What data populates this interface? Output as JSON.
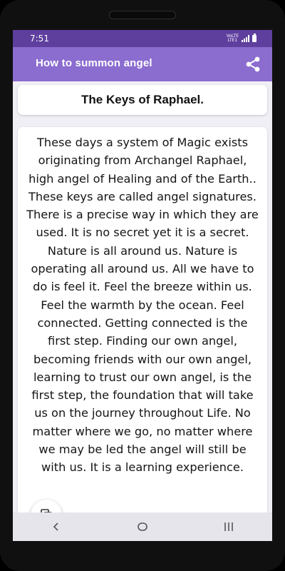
{
  "status_bar": {
    "time": "7:51",
    "network_label_1": "VoLTE",
    "network_label_2": "LTE1"
  },
  "app_bar": {
    "title": "How to summon angel",
    "share_icon": "share-icon"
  },
  "article": {
    "title": "The Keys of Raphael.",
    "body": "These days a system of Magic exists originating from Archangel Raphael, high angel of Healing and of the Earth.. These keys are called angel signatures. There is a precise way in which they are used. It is no secret yet it is a secret. Nature is all around us. Nature is operating all around us. All we have to do is feel it. Feel the breeze within us. Feel the warmth by the ocean. Feel connected. Getting connected is the first step. Finding our own angel, becoming friends with our own angel, learning to trust our own angel, is the first step, the foundation that will take us on the journey throughout Life. No matter where we go, no matter where we may be led the angel will still be with us. It is a learning experience."
  },
  "fab": {
    "icon": "copy-icon"
  },
  "nav_bar": {
    "back_icon": "back-icon",
    "home_icon": "home-icon",
    "recents_icon": "recents-icon"
  },
  "colors": {
    "status_bar": "#5e3f9e",
    "app_bar": "#8b6ccf",
    "background": "#f0eff6",
    "card": "#ffffff"
  }
}
